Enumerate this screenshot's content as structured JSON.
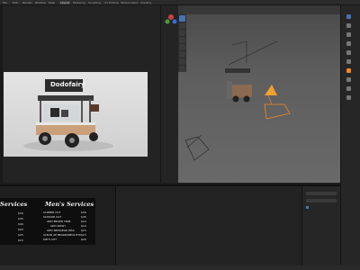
{
  "menu": {
    "items": [
      "File",
      "Edit",
      "Render",
      "Window",
      "Help"
    ],
    "workspace_tabs": [
      "Layout",
      "Modeling",
      "Sculpting",
      "UV Editing",
      "Texture Paint",
      "Shading"
    ],
    "active_tab": "Layout"
  },
  "render": {
    "sign_text": "Dodofairy"
  },
  "menu_board": {
    "left_title": "Services",
    "left_prices": [
      "$30",
      "$35",
      "$40",
      "$20",
      "$25",
      "$15"
    ],
    "right_title": "Men's Services",
    "right_items": [
      {
        "name": "CLIPPER CUT",
        "price": "$30"
      },
      {
        "name": "SCISSOR CUT",
        "price": "$35"
      },
      {
        "name": "ADD BEARD TRIM",
        "price": "$10"
      },
      {
        "name": "ADD WASH",
        "price": "$10"
      },
      {
        "name": "ADD NECK/EAR WAX",
        "price": "$15"
      },
      {
        "name": "CLEAN UP BEARD/NECK ETC",
        "price": "$15"
      },
      {
        "name": "KID'S CUT",
        "price": "$20"
      }
    ]
  },
  "colors": {
    "accent": "#4772b3",
    "camera_orange": "#f0a030",
    "selection": "#f08a24"
  },
  "icons": [
    "gizmo-axis-icon",
    "hand-pan-icon",
    "camera-icon",
    "zoom-icon",
    "select-box-icon",
    "move-icon",
    "rotate-icon",
    "scale-icon"
  ]
}
